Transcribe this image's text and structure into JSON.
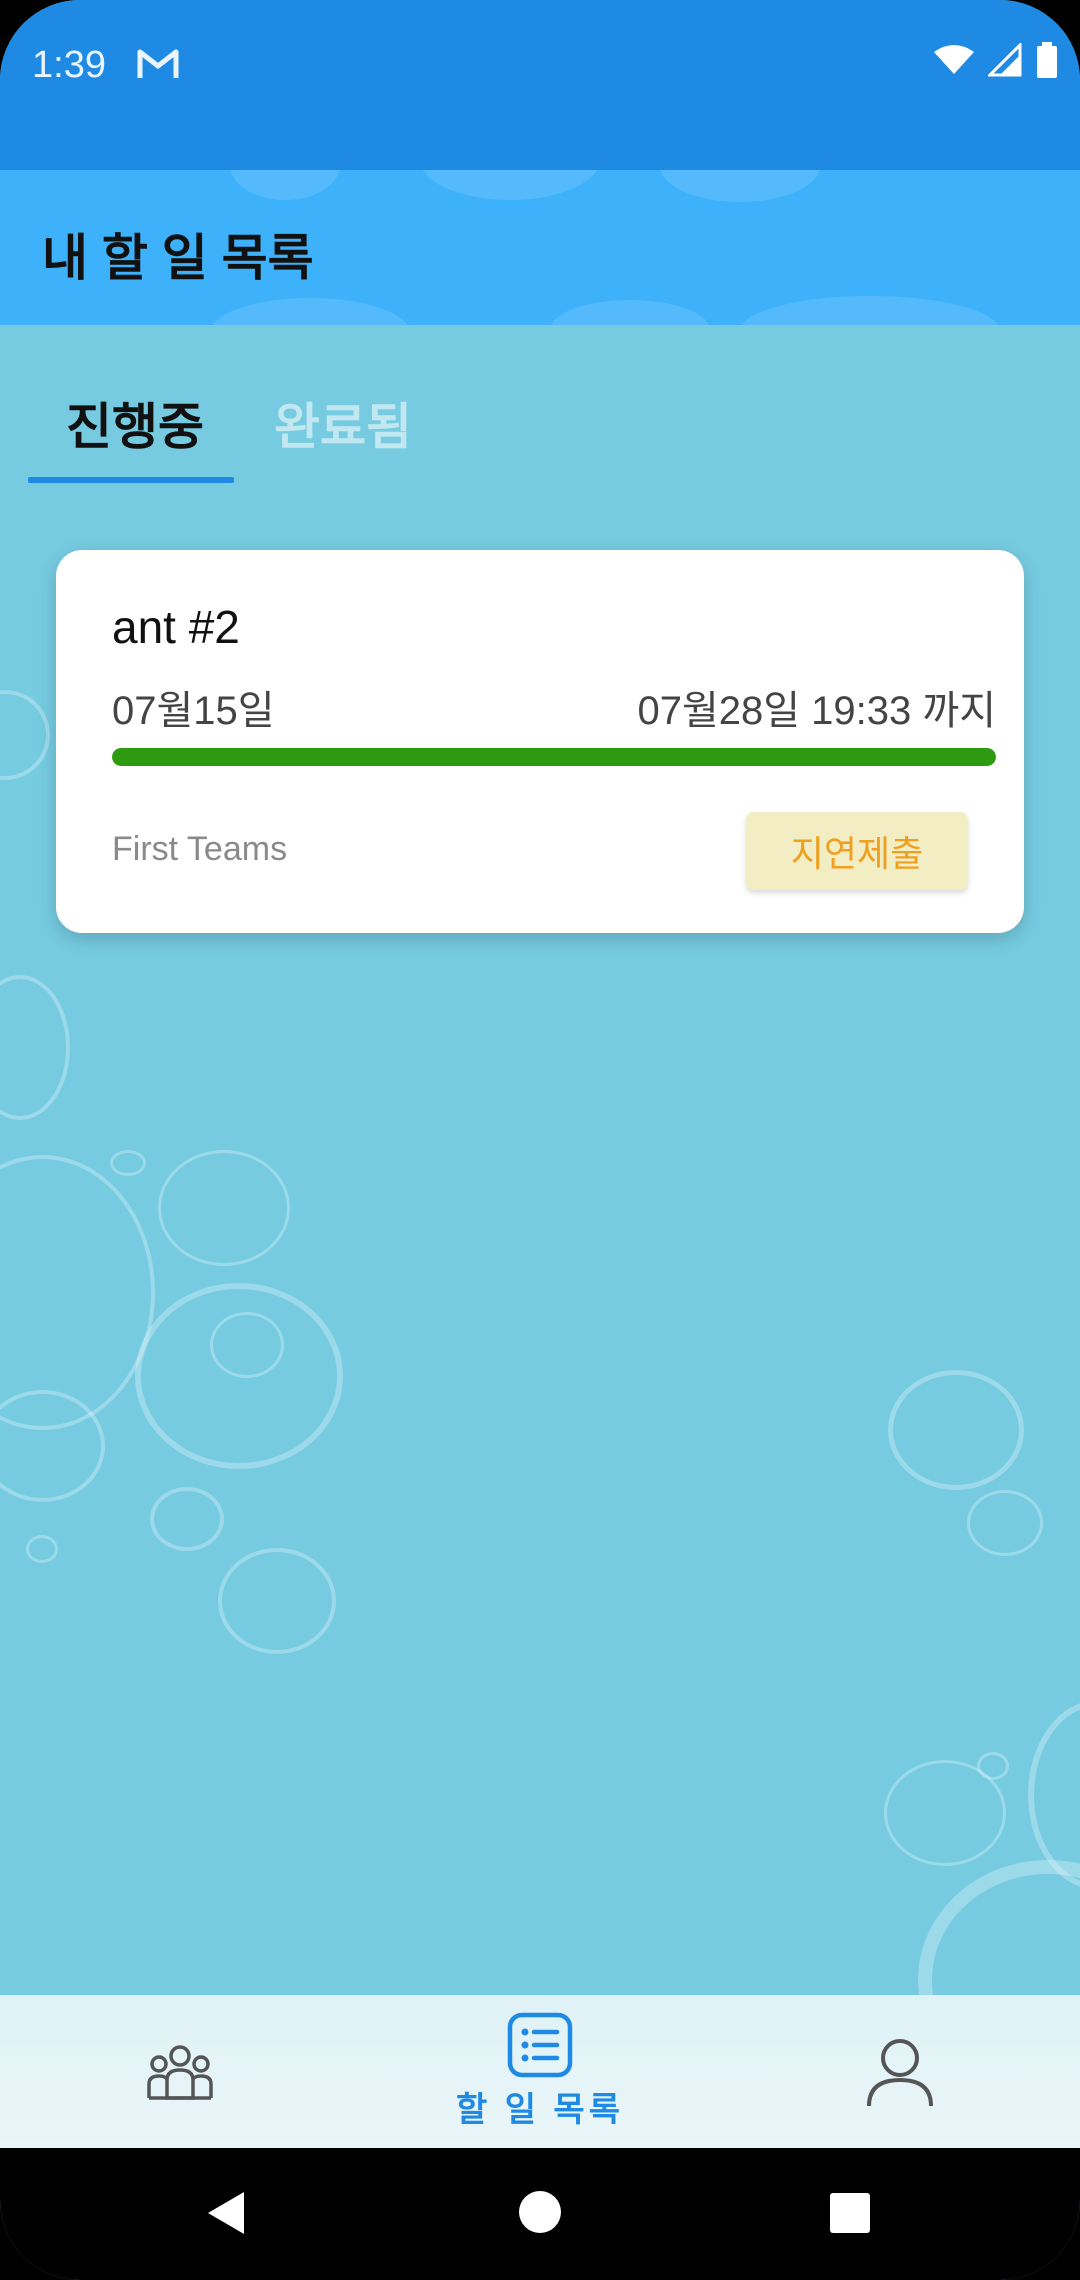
{
  "status_bar": {
    "time": "1:39",
    "icons": [
      "gmail-icon",
      "wifi-icon",
      "signal-icon",
      "battery-icon"
    ]
  },
  "app_bar": {
    "title": "내 할 일 목록"
  },
  "tabs": [
    {
      "label": "진행중",
      "active": true
    },
    {
      "label": "완료됨",
      "active": false
    }
  ],
  "task_card": {
    "name": "ant #2",
    "start_date": "07월15일",
    "due_date": "07월28일 19:33 까지",
    "progress": 1.0,
    "team": "First Teams",
    "status_button": "지연제출"
  },
  "bottom_nav": {
    "items": [
      {
        "icon": "teams-icon",
        "label": ""
      },
      {
        "icon": "todo-list-icon",
        "label": "할 일 목록",
        "active": true
      },
      {
        "icon": "profile-icon",
        "label": ""
      }
    ]
  },
  "colors": {
    "accent": "#1f8ae4",
    "app_bar": "#3eb1fb",
    "background": "#76cbe1",
    "progress": "#2e9a10",
    "late_button_bg": "#f3edc4",
    "late_button_text": "#f0a020"
  }
}
